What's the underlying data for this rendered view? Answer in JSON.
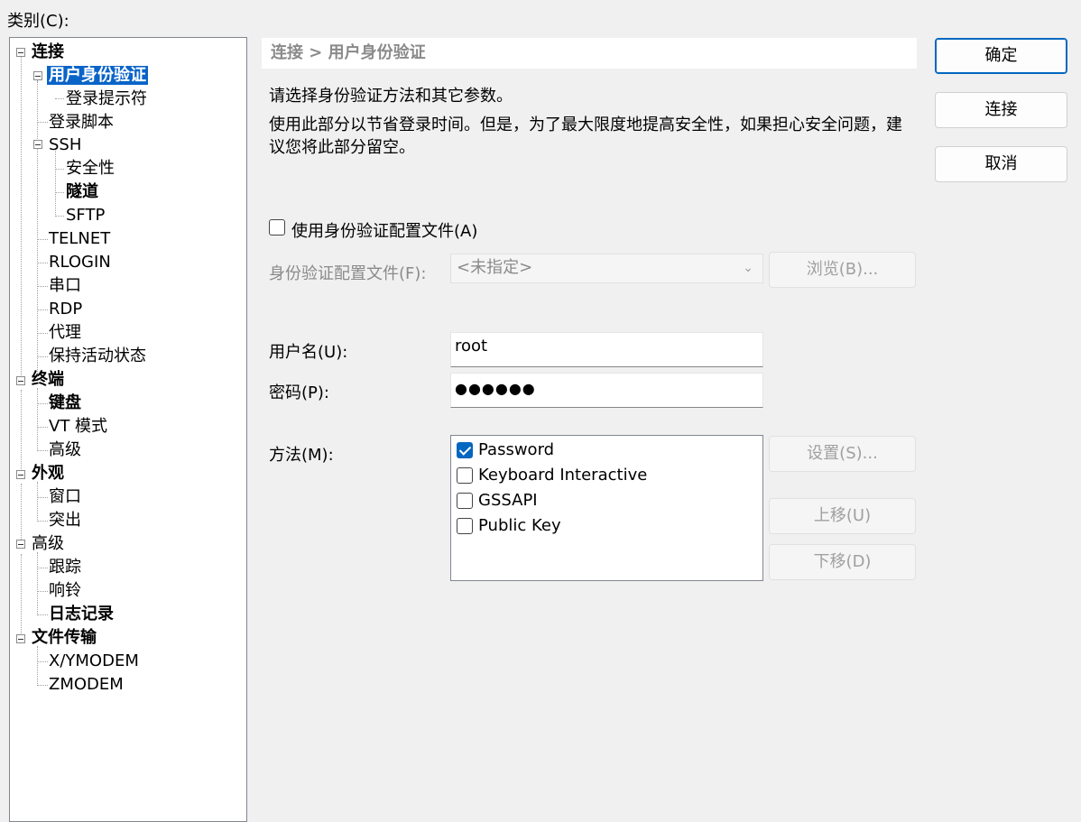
{
  "category_label": "类别(C):",
  "tree": {
    "nodes": [
      {
        "label": "连接",
        "bold": true
      },
      {
        "label": "用户身份验证",
        "bold": true,
        "selected": true
      },
      {
        "label": "登录提示符"
      },
      {
        "label": "登录脚本"
      },
      {
        "label": "SSH"
      },
      {
        "label": "安全性"
      },
      {
        "label": "隧道",
        "bold": true
      },
      {
        "label": "SFTP"
      },
      {
        "label": "TELNET"
      },
      {
        "label": "RLOGIN"
      },
      {
        "label": "串口"
      },
      {
        "label": "RDP"
      },
      {
        "label": "代理"
      },
      {
        "label": "保持活动状态"
      },
      {
        "label": "终端",
        "bold": true
      },
      {
        "label": "键盘",
        "bold": true
      },
      {
        "label": "VT 模式"
      },
      {
        "label": "高级"
      },
      {
        "label": "外观",
        "bold": true
      },
      {
        "label": "窗口"
      },
      {
        "label": "突出"
      },
      {
        "label": "高级"
      },
      {
        "label": "跟踪"
      },
      {
        "label": "响铃"
      },
      {
        "label": "日志记录",
        "bold": true
      },
      {
        "label": "文件传输",
        "bold": true
      },
      {
        "label": "X/YMODEM"
      },
      {
        "label": "ZMODEM"
      }
    ]
  },
  "breadcrumb": "连接 > 用户身份验证",
  "description": {
    "line1": "请选择身份验证方法和其它参数。",
    "line2a": "使用此部分以节省登录时间。但是，为了最大限度地提高安全性，如果担心安全问题，建",
    "line2b": "议您将此部分留空。"
  },
  "use_profile_label": "使用身份验证配置文件(A)",
  "profile": {
    "label": "身份验证配置文件(F):",
    "value": "<未指定>",
    "browse_label": "浏览(B)..."
  },
  "username": {
    "label": "用户名(U):",
    "value": "root"
  },
  "password": {
    "label": "密码(P):",
    "value": "●●●●●●"
  },
  "method": {
    "label": "方法(M):",
    "items": [
      {
        "label": "Password",
        "checked": true
      },
      {
        "label": "Keyboard Interactive",
        "checked": false
      },
      {
        "label": "GSSAPI",
        "checked": false
      },
      {
        "label": "Public Key",
        "checked": false
      }
    ],
    "settings_label": "设置(S)...",
    "move_up_label": "上移(U)",
    "move_down_label": "下移(D)"
  },
  "buttons": {
    "ok": "确定",
    "connect": "连接",
    "cancel": "取消"
  },
  "colors": {
    "selection": "#0a64c8",
    "accent": "#0067c0",
    "background": "#f0f0f0"
  }
}
